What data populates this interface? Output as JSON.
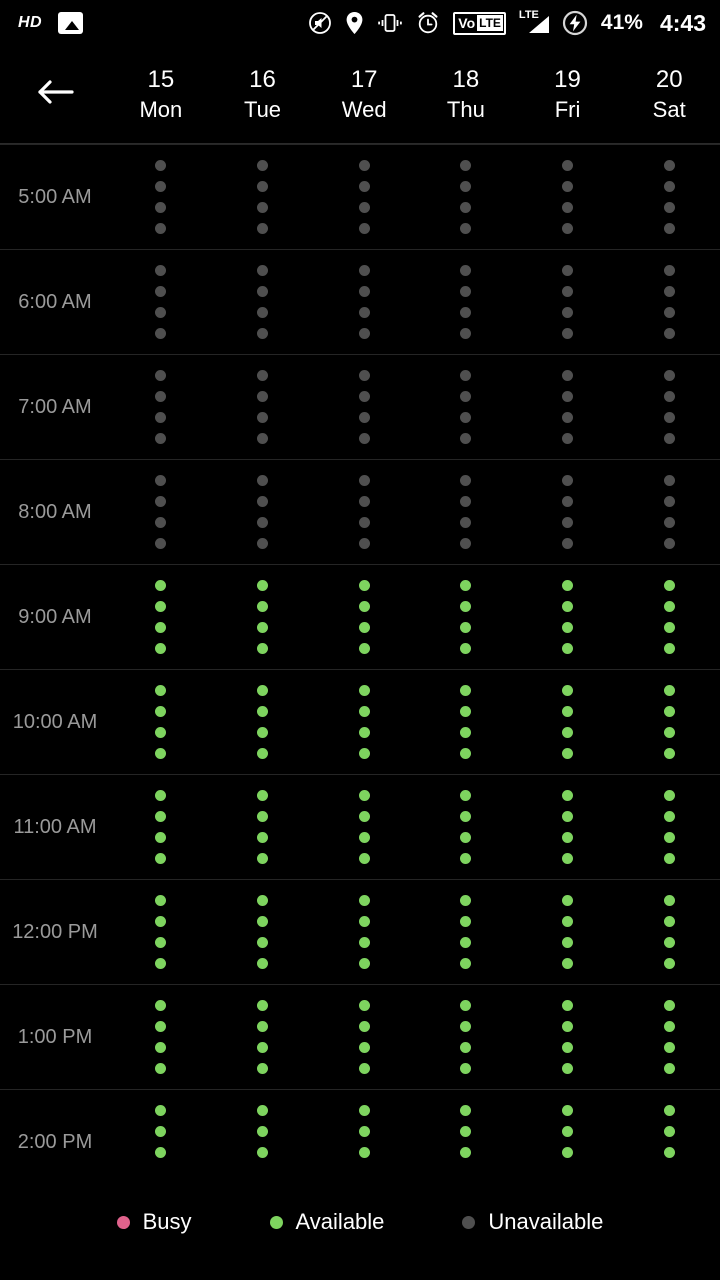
{
  "status_bar": {
    "hd_label": "HD",
    "photo_icon": "image-icon",
    "icons": [
      "sound-muted-icon",
      "location-pin-icon",
      "vibrate-icon",
      "alarm-clock-icon"
    ],
    "volte_vo": "Vo",
    "volte_lte": "LTE",
    "signal_label": "LTE",
    "battery_percent": "41%",
    "time": "4:43"
  },
  "header": {
    "back_icon": "back-arrow-icon",
    "days": [
      {
        "num": "15",
        "name": "Mon"
      },
      {
        "num": "16",
        "name": "Tue"
      },
      {
        "num": "17",
        "name": "Wed"
      },
      {
        "num": "18",
        "name": "Thu"
      },
      {
        "num": "19",
        "name": "Fri"
      },
      {
        "num": "20",
        "name": "Sat"
      }
    ]
  },
  "schedule": {
    "slots_per_cell": 4,
    "rows": [
      {
        "time": "5:00 AM",
        "cells": [
          "unavailable",
          "unavailable",
          "unavailable",
          "unavailable",
          "unavailable",
          "unavailable"
        ]
      },
      {
        "time": "6:00 AM",
        "cells": [
          "unavailable",
          "unavailable",
          "unavailable",
          "unavailable",
          "unavailable",
          "unavailable"
        ]
      },
      {
        "time": "7:00 AM",
        "cells": [
          "unavailable",
          "unavailable",
          "unavailable",
          "unavailable",
          "unavailable",
          "unavailable"
        ]
      },
      {
        "time": "8:00 AM",
        "cells": [
          "unavailable",
          "unavailable",
          "unavailable",
          "unavailable",
          "unavailable",
          "unavailable"
        ]
      },
      {
        "time": "9:00 AM",
        "cells": [
          "available",
          "available",
          "available",
          "available",
          "available",
          "available"
        ]
      },
      {
        "time": "10:00 AM",
        "cells": [
          "available",
          "available",
          "available",
          "available",
          "available",
          "available"
        ]
      },
      {
        "time": "11:00 AM",
        "cells": [
          "available",
          "available",
          "available",
          "available",
          "available",
          "available"
        ]
      },
      {
        "time": "12:00 PM",
        "cells": [
          "available",
          "available",
          "available",
          "available",
          "available",
          "available"
        ]
      },
      {
        "time": "1:00 PM",
        "cells": [
          "available",
          "available",
          "available",
          "available",
          "available",
          "available"
        ]
      },
      {
        "time": "2:00 PM",
        "cells": [
          "available",
          "available",
          "available",
          "available",
          "available",
          "available"
        ]
      }
    ]
  },
  "legend": {
    "items": [
      {
        "label": "Busy",
        "state": "busy",
        "color": "#e0628c"
      },
      {
        "label": "Available",
        "state": "available",
        "color": "#7ed45f"
      },
      {
        "label": "Unavailable",
        "state": "unavailable",
        "color": "#4f4f4f"
      }
    ]
  }
}
